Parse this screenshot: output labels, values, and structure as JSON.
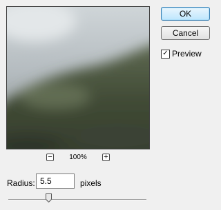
{
  "dialog": {
    "ok_label": "OK",
    "cancel_label": "Cancel",
    "preview_label": "Preview",
    "preview_checked": true
  },
  "zoom": {
    "minus_label": "−",
    "plus_label": "+",
    "level": "100%"
  },
  "radius": {
    "label": "Radius:",
    "value": "5.5",
    "unit": "pixels",
    "slider_fraction": 0.29
  }
}
